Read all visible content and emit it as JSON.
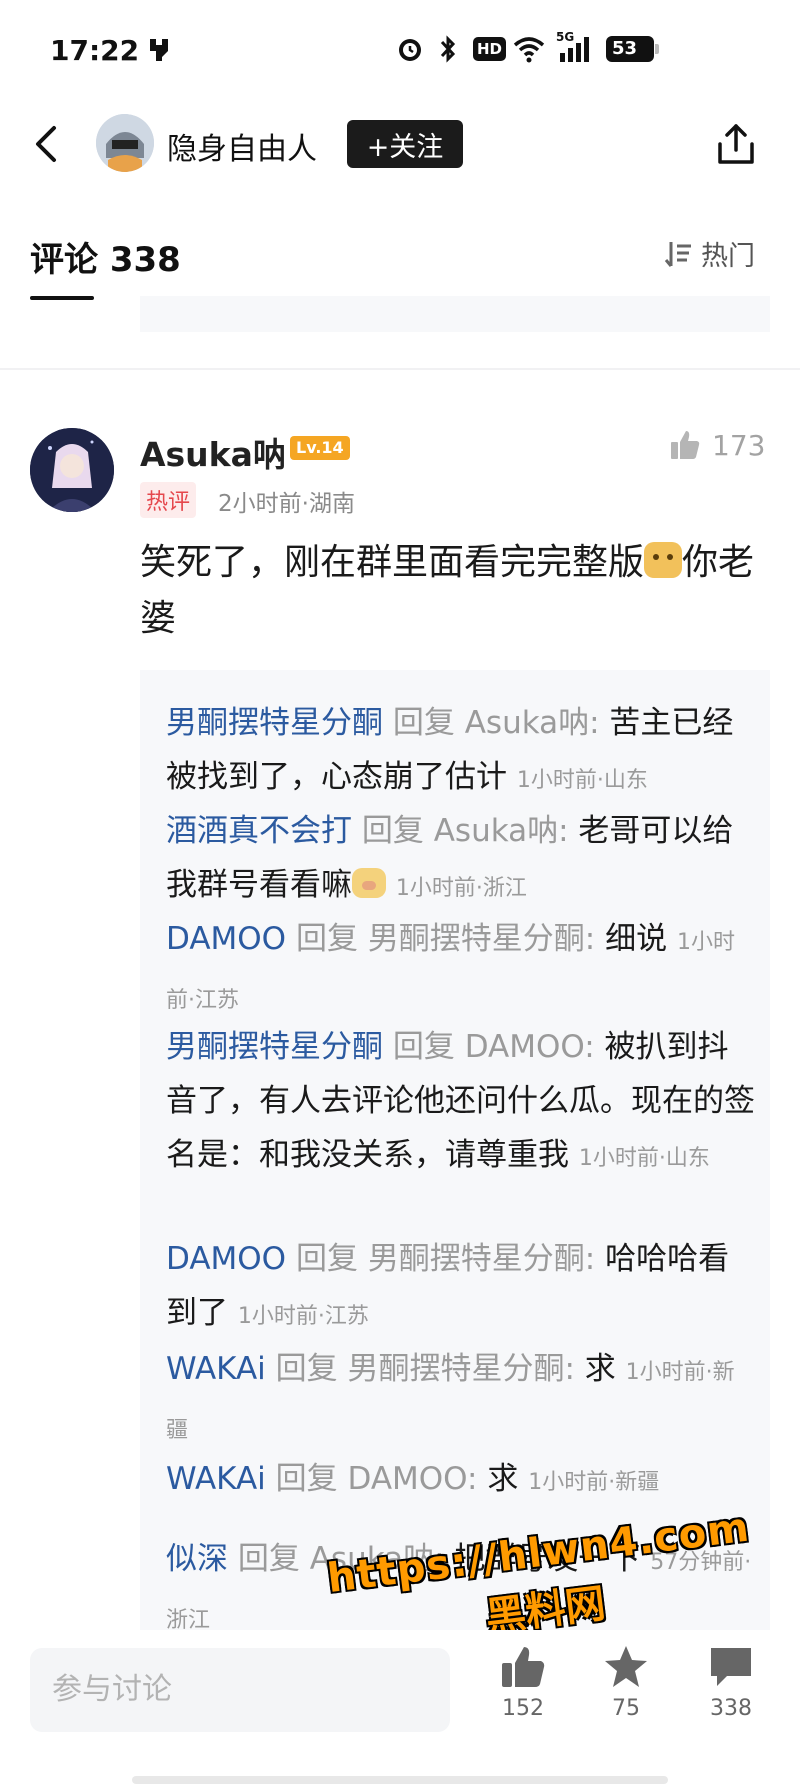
{
  "status_bar": {
    "time": "17:22",
    "hd": "HD",
    "network": "5G",
    "battery": "53"
  },
  "header": {
    "author_name": "隐身自由人",
    "follow_label": "+关注",
    "icons": [
      "back-icon",
      "share-icon"
    ]
  },
  "comments_section": {
    "title": "评论 338",
    "sort_label": "热门"
  },
  "comment": {
    "user": "Asuka呐",
    "level": "Lv.14",
    "likes": "173",
    "hot_tag": "热评",
    "meta": "2小时前·湖南",
    "text_part1": "笑死了，刚在群里面看完完整版",
    "text_part2": "你老婆"
  },
  "replies": [
    {
      "name": "男酮摆特星分酮",
      "verb": "回复",
      "target": "Asuka呐:",
      "text": " 苦主已经被找到了，心态崩了估计",
      "meta": "1小时前·山东"
    },
    {
      "name": "酒酒真不会打",
      "verb": "回复",
      "target": "Asuka呐:",
      "text": " 老哥可以给我群号看看嘛",
      "meta": "1小时前·浙江"
    },
    {
      "name": "DAMOO",
      "verb": "回复",
      "target": "男酮摆特星分酮:",
      "text": " 细说",
      "meta": "1小时前·江苏"
    },
    {
      "name": "男酮摆特星分酮",
      "verb": "回复",
      "target": "DAMOO:",
      "text": " 被扒到抖音了，有人去评论他还问什么瓜。现在的签名是：和我没关系，请尊重我",
      "meta": "1小时前·山东"
    },
    {
      "name": "DAMOO",
      "verb": "回复",
      "target": "男酮摆特星分酮:",
      "text": " 哈哈哈看到了",
      "meta": "1小时前·江苏"
    },
    {
      "name": "WAKAi",
      "verb": "回复",
      "target": "男酮摆特星分酮:",
      "text": " 求",
      "meta": "1小时前·新疆"
    },
    {
      "name": "WAKAi",
      "verb": "回复",
      "target": "DAMOO:",
      "text": " 求",
      "meta": "1小时前·新疆"
    },
    {
      "name": "似深",
      "verb": "回复",
      "target": "Asuka呐:",
      "text": " 把群号发一下",
      "meta": "57分钟前·浙江"
    }
  ],
  "watermark": {
    "line1": "https://hlwn4.com",
    "line2": "黑料网"
  },
  "bottom_bar": {
    "input_placeholder": "参与讨论",
    "like_count": "152",
    "favorite_count": "75",
    "comment_count": "338"
  }
}
